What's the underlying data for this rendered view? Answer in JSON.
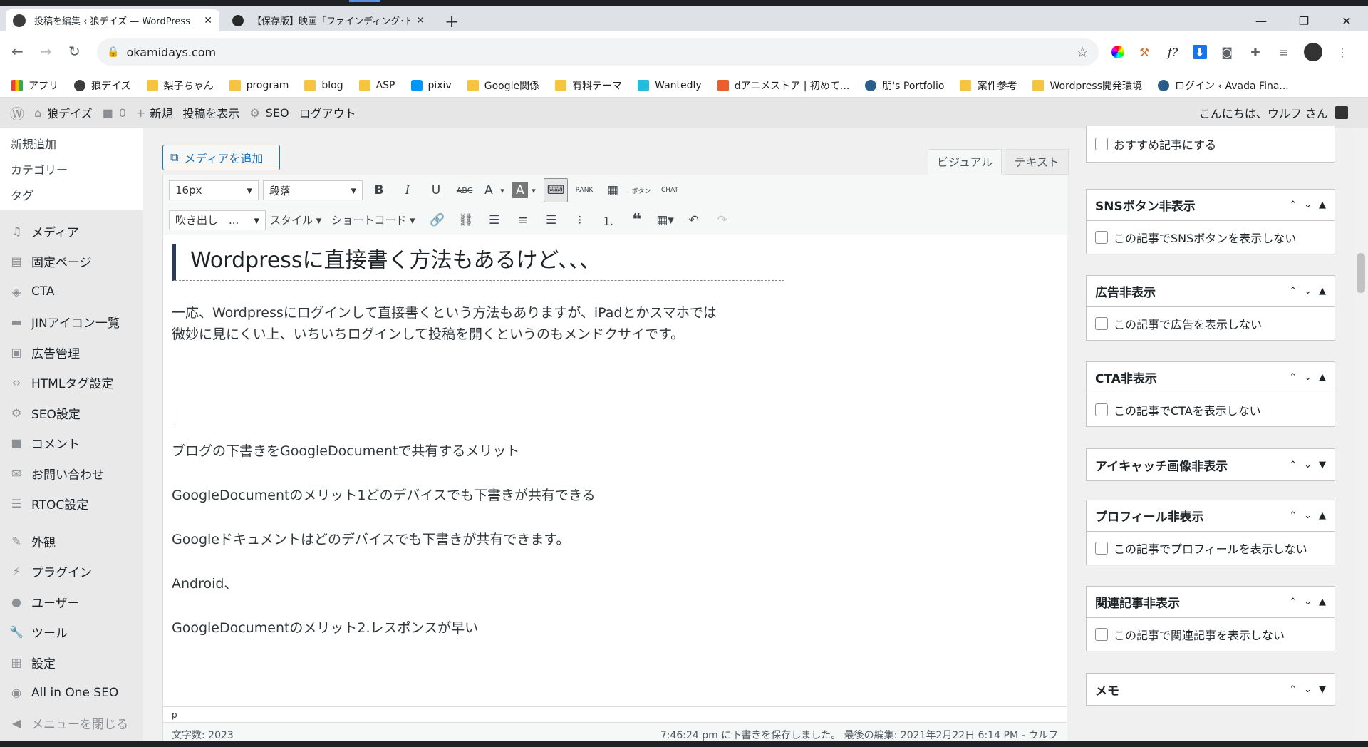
{
  "browser": {
    "tabs": [
      {
        "title": "投稿を編集 ‹ 狼デイズ — WordPress",
        "close": "✕"
      },
      {
        "title": "【保存版】映画「ファインディング･ドリー」",
        "close": "✕"
      }
    ],
    "new_tab": "+",
    "window_controls": {
      "minimize": "—",
      "maximize": "❐",
      "close": "✕"
    },
    "url": "okamidays.com",
    "bookmarks": [
      "アプリ",
      "狼デイズ",
      "梨子ちゃん",
      "program",
      "blog",
      "ASP",
      "pixiv",
      "Google関係",
      "有料テーマ",
      "Wantedly",
      "dアニメストア | 初めて...",
      "朋's Portfolio",
      "案件参考",
      "Wordpress開発環境",
      "ログイン ‹ Avada Fina..."
    ]
  },
  "adminbar": {
    "site": "狼デイズ",
    "comments": "0",
    "new": "新規",
    "view_post": "投稿を表示",
    "seo": "SEO",
    "logout": "ログアウト",
    "greeting": "こんにちは、ウルフ さん"
  },
  "sidebar": {
    "submenu": [
      "新規追加",
      "カテゴリー",
      "タグ"
    ],
    "items": [
      "メディア",
      "固定ページ",
      "CTA",
      "JINアイコン一覧",
      "広告管理",
      "HTMLタグ設定",
      "SEO設定",
      "コメント",
      "お問い合わせ",
      "RTOC設定",
      "外観",
      "プラグイン",
      "ユーザー",
      "ツール",
      "設定",
      "All in One SEO"
    ],
    "collapse": "メニューを閉じる"
  },
  "editor": {
    "add_media": "メディアを追加",
    "tab_visual": "ビジュアル",
    "tab_text": "テキスト",
    "font_size": "16px",
    "format": "段落",
    "balloon": "吹き出し　...",
    "style": "スタイル",
    "shortcode": "ショートコード",
    "heading": "Wordpressに直接書く方法もあるけど、、、",
    "para1": "一応、Wordpressにログインして直接書くという方法もありますが、iPadとかスマホでは",
    "para2": "微妙に見にくい上、いちいちログインして投稿を開くというのもメンドクサイです。",
    "lines": [
      "ブログの下書きをGoogleDocumentで共有するメリット",
      "GoogleDocumentのメリット1どのデバイスでも下書きが共有できる",
      "Googleドキュメントはどのデバイスでも下書きが共有できます。",
      "Android、",
      "GoogleDocumentのメリット2.レスポンスが早い"
    ],
    "path": "p",
    "word_count": "文字数: 2023",
    "save_status": "7:46:24 pm に下書きを保存しました。 最後の編集: 2021年2月22日 6:14 PM - ウルフ"
  },
  "metaboxes": {
    "recommend": "おすすめ記事にする",
    "boxes": [
      {
        "title": "SNSボタン非表示",
        "option": "この記事でSNSボタンを表示しない"
      },
      {
        "title": "広告非表示",
        "option": "この記事で広告を表示しない"
      },
      {
        "title": "CTA非表示",
        "option": "この記事でCTAを表示しない"
      },
      {
        "title": "アイキャッチ画像非表示",
        "option": ""
      },
      {
        "title": "プロフィール非表示",
        "option": "この記事でプロフィールを表示しない"
      },
      {
        "title": "関連記事非表示",
        "option": "この記事で関連記事を表示しない"
      },
      {
        "title": "メモ",
        "option": ""
      }
    ]
  },
  "colors": {
    "accent": "#2271b1",
    "wp_dark": "#1d2327",
    "tab_bg": "#dee1e6"
  }
}
